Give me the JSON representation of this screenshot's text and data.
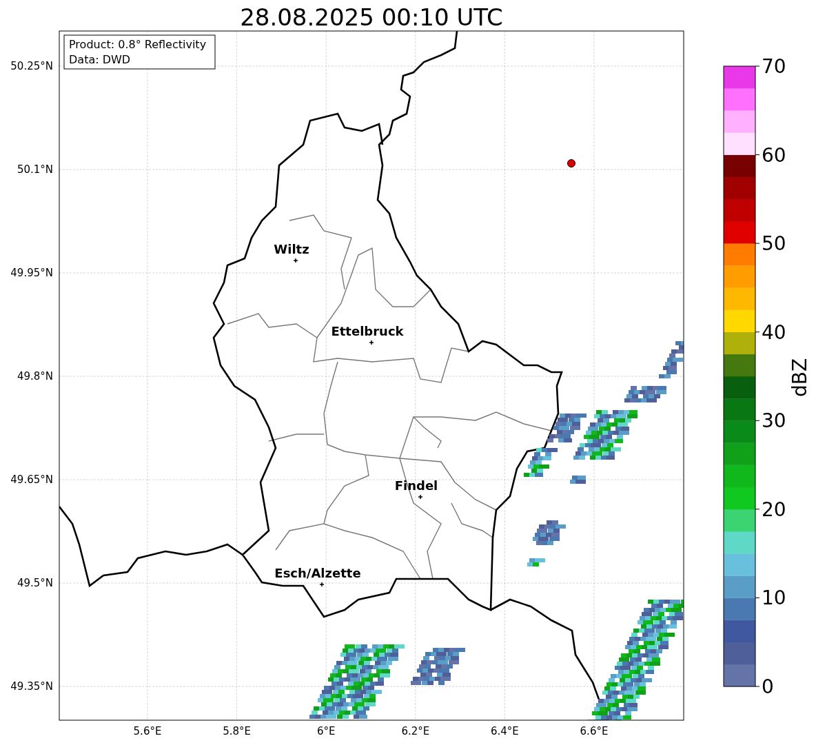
{
  "title": "28.08.2025 00:10 UTC",
  "info_box": [
    "Product: 0.8° Reflectivity",
    "Data: DWD"
  ],
  "map": {
    "y_ticks": [
      "50.25°N",
      "50.1°N",
      "49.95°N",
      "49.8°N",
      "49.65°N",
      "49.5°N",
      "49.35°N"
    ],
    "x_ticks": [
      "5.6°E",
      "5.8°E",
      "6°E",
      "6.2°E",
      "6.4°E",
      "6.6°E"
    ],
    "places": [
      {
        "name": "Wiltz"
      },
      {
        "name": "Ettelbruck"
      },
      {
        "name": "Findel"
      },
      {
        "name": "Esch/Alzette"
      }
    ]
  },
  "colorbar": {
    "label": "dBZ",
    "ticks": [
      "70",
      "60",
      "50",
      "40",
      "30",
      "20",
      "10",
      "0"
    ],
    "segments": [
      {
        "color": "#6474a8"
      },
      {
        "color": "#4f5f9a"
      },
      {
        "color": "#4058a0"
      },
      {
        "color": "#4a78b0"
      },
      {
        "color": "#5a9ec8"
      },
      {
        "color": "#68c0dc"
      },
      {
        "color": "#60d8c8"
      },
      {
        "color": "#3cd472"
      },
      {
        "color": "#10c820"
      },
      {
        "color": "#10b81c"
      },
      {
        "color": "#10a01a"
      },
      {
        "color": "#0a8a18"
      },
      {
        "color": "#0a7812"
      },
      {
        "color": "#08600f"
      },
      {
        "color": "#467810"
      },
      {
        "color": "#b0b00a"
      },
      {
        "color": "#ffd800"
      },
      {
        "color": "#ffb800"
      },
      {
        "color": "#ff9c00"
      },
      {
        "color": "#ff7c00"
      },
      {
        "color": "#e00000"
      },
      {
        "color": "#c00000"
      },
      {
        "color": "#a00000"
      },
      {
        "color": "#780000"
      },
      {
        "color": "#ffe0ff"
      },
      {
        "color": "#ffb0ff"
      },
      {
        "color": "#ff70ff"
      },
      {
        "color": "#e838e8"
      }
    ]
  }
}
